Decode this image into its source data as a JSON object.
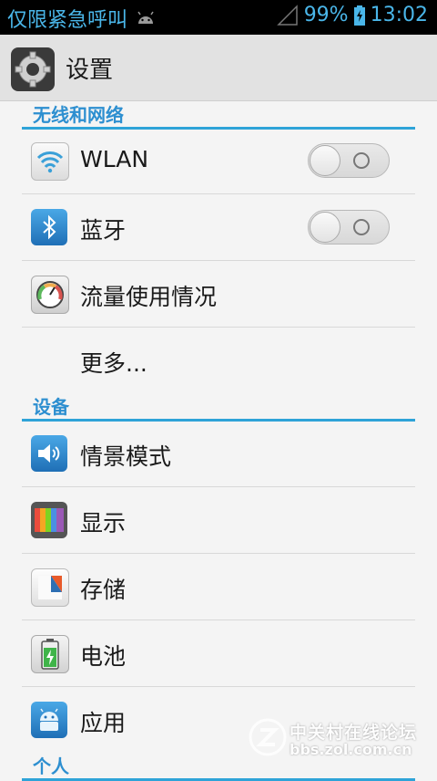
{
  "status_bar": {
    "notification_text": "仅限紧急呼叫",
    "battery_percent": "99%",
    "time": "13:02",
    "icons": [
      "android-icon",
      "signal-icon",
      "battery-charging-icon"
    ]
  },
  "action_bar": {
    "title": "设置",
    "icon": "settings-gear-icon"
  },
  "sections": [
    {
      "header": "无线和网络",
      "items": [
        {
          "label": "WLAN",
          "icon": "wifi-icon",
          "toggle": "off"
        },
        {
          "label": "蓝牙",
          "icon": "bluetooth-icon",
          "toggle": "off"
        },
        {
          "label": "流量使用情况",
          "icon": "data-usage-gauge-icon"
        },
        {
          "label": "更多..."
        }
      ]
    },
    {
      "header": "设备",
      "items": [
        {
          "label": "情景模式",
          "icon": "sound-profile-icon"
        },
        {
          "label": "显示",
          "icon": "display-icon"
        },
        {
          "label": "存储",
          "icon": "storage-icon"
        },
        {
          "label": "电池",
          "icon": "battery-icon"
        },
        {
          "label": "应用",
          "icon": "apps-android-icon"
        }
      ]
    },
    {
      "header": "个人",
      "items": []
    }
  ],
  "watermark": {
    "line1": "中关村在线论坛",
    "line2": "bbs.zol.com.cn"
  },
  "colors": {
    "accent": "#2ea3d8",
    "status_text": "#4ab6e9",
    "background": "#f4f4f4"
  }
}
